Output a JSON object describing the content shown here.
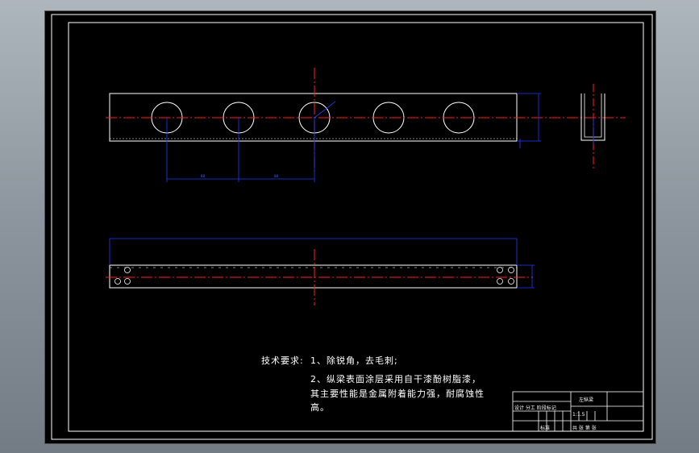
{
  "notes": {
    "heading": "技术要求:",
    "line1": "1、除锐角，去毛刺;",
    "line2": "2、纵梁表面涂层采用自干漆酚树脂漆，",
    "line3": "其主要性能是金属附着能力强，耐腐蚀性",
    "line4": "高。"
  },
  "title_block": {
    "part_name": "左纵梁",
    "scale": "1:1.5",
    "row_a": "设计  分工 阶段标记",
    "row_b": "标准",
    "row_c": "共  张  第  张"
  },
  "colors": {
    "background": "#000000",
    "part_lines": "#ffffff",
    "centerlines": "#ff2020",
    "dimensions": "#1e3cff",
    "frame": "#ffffff"
  }
}
